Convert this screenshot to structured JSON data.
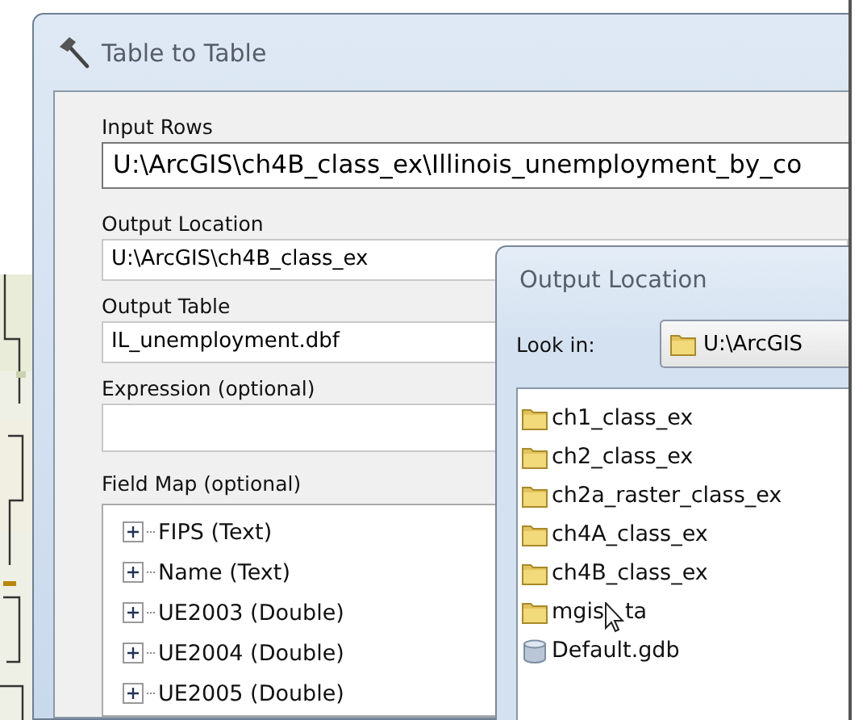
{
  "window": {
    "title": "Table to Table"
  },
  "form": {
    "fields": [
      {
        "label": "Input Rows",
        "value": "U:\\ArcGIS\\ch4B_class_ex\\Illinois_unemployment_by_co",
        "wide": true
      },
      {
        "label": "Output Location",
        "value": "U:\\ArcGIS\\ch4B_class_ex"
      },
      {
        "label": "Output Table",
        "value": "IL_unemployment.dbf"
      },
      {
        "label": "Expression (optional)"
      }
    ],
    "field_map": {
      "label": "Field Map (optional)",
      "items": [
        {
          "name": "FIPS (Text)",
          "expanded": false
        },
        {
          "name": "Name (Text)",
          "expanded": false
        },
        {
          "name": "UE2003 (Double)",
          "expanded": false
        },
        {
          "name": "UE2004 (Double)",
          "expanded": false
        },
        {
          "name": "UE2005 (Double)",
          "expanded": false
        }
      ]
    }
  },
  "dialog": {
    "title": "Output Location",
    "look_in": {
      "label": "Look in:",
      "value": "U:\\ArcGIS"
    },
    "items": [
      {
        "name": "ch1_class_ex",
        "kind": "folder"
      },
      {
        "name": "ch2_class_ex",
        "kind": "folder"
      },
      {
        "name": "ch2a_raster_class_ex",
        "kind": "folder"
      },
      {
        "name": "ch4A_class_ex",
        "kind": "folder"
      },
      {
        "name": "ch4B_class_ex",
        "kind": "folder"
      },
      {
        "name": "mgis",
        "tail": "ta",
        "kind": "folder"
      },
      {
        "name": "Default.gdb",
        "kind": "database"
      }
    ]
  }
}
